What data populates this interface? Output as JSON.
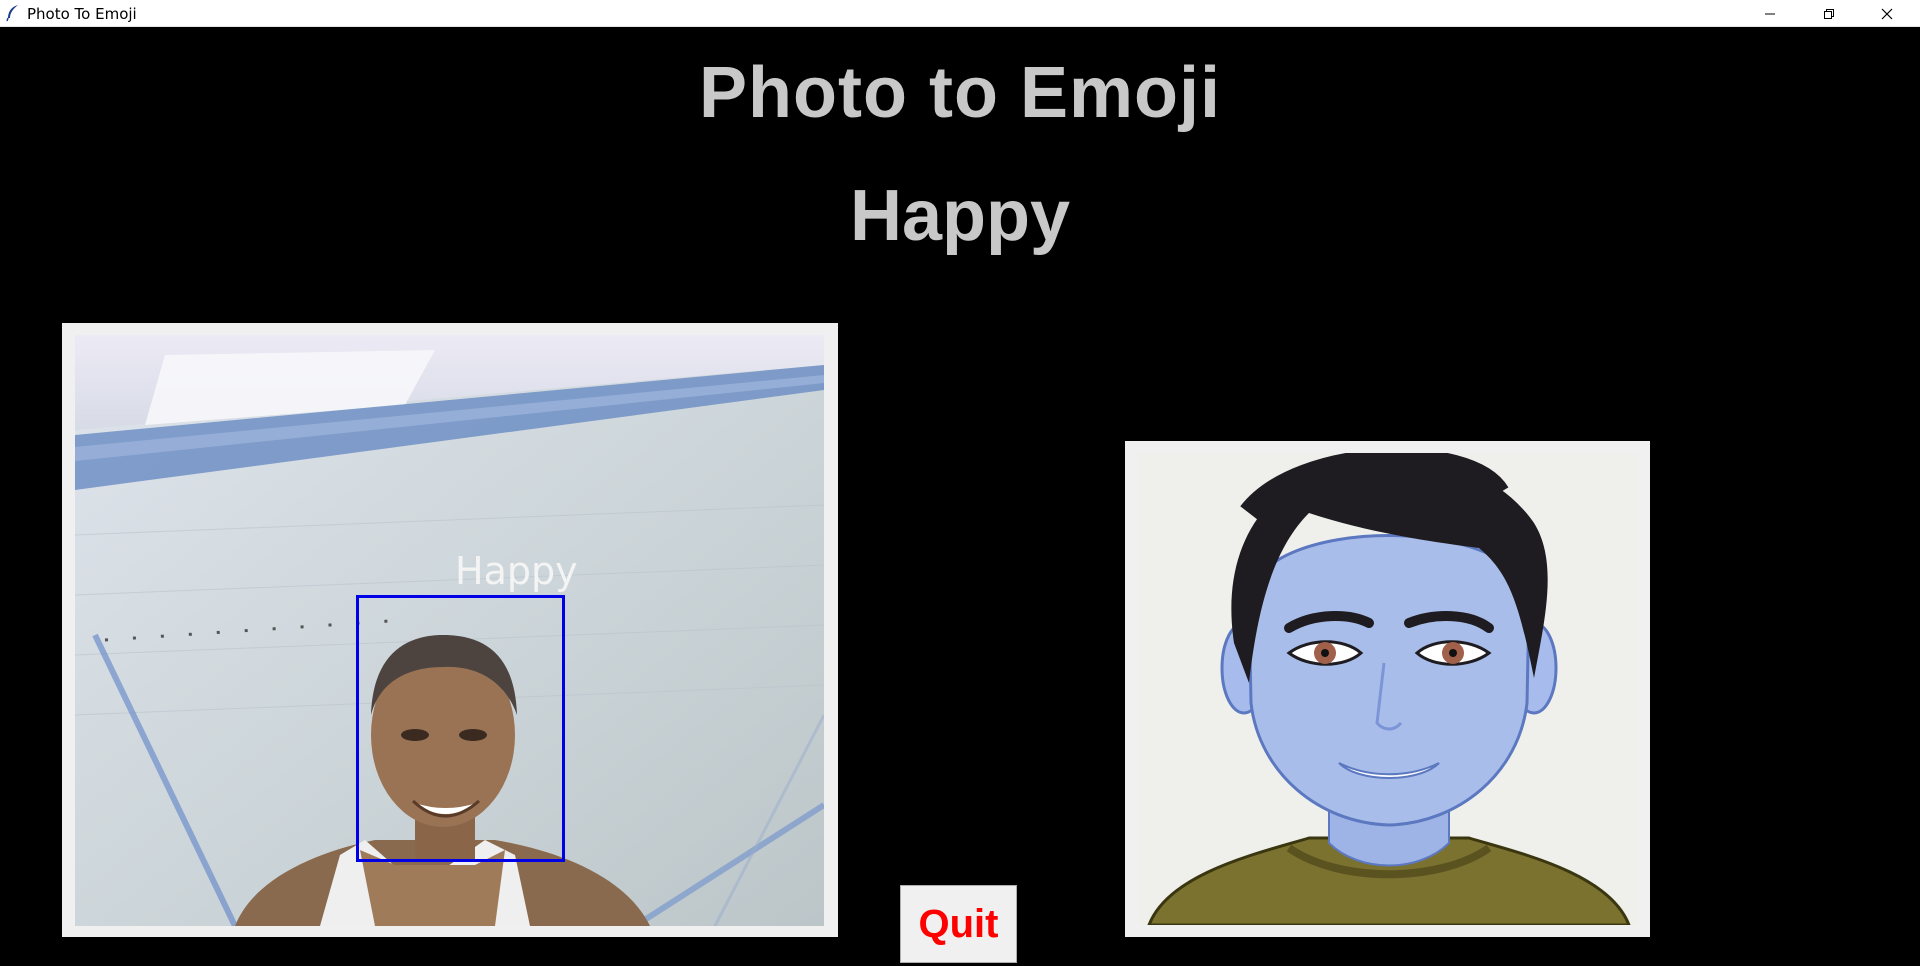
{
  "window": {
    "title": "Photo To Emoji",
    "icon": "feather-icon",
    "controls": [
      "minimize-icon",
      "restore-icon",
      "close-icon"
    ]
  },
  "heading": {
    "title": "Photo to Emoji",
    "emotion": "Happy"
  },
  "webcam": {
    "overlay_label": "Happy",
    "box_color": "#0000e6"
  },
  "quit_button": {
    "label": "Quit",
    "color": "#ff0000"
  },
  "colors": {
    "background": "#000000",
    "heading": "#c8c8c8",
    "panel": "#f0f0f0",
    "avatar_skin": "#a9bdea"
  }
}
